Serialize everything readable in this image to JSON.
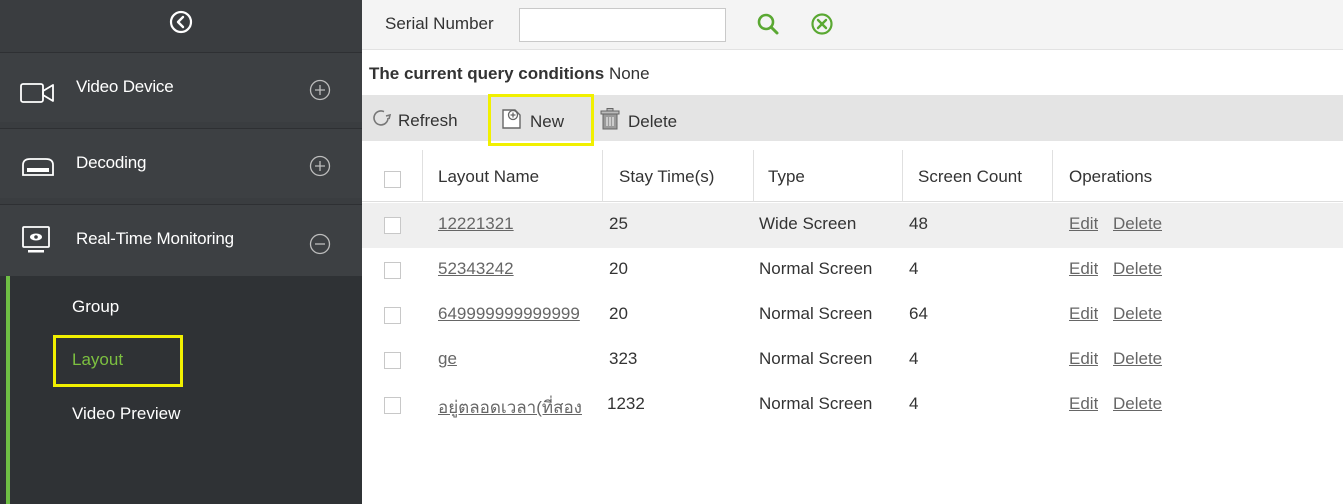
{
  "sidebar": {
    "collapse_icon": "circle-chevron-left-icon",
    "items": [
      {
        "label": "Video Device",
        "icon": "video-camera-icon",
        "toggle": "plus"
      },
      {
        "label": "Decoding",
        "icon": "decoder-icon",
        "toggle": "plus"
      },
      {
        "label": "Real-Time Monitoring",
        "icon": "monitor-eye-icon",
        "toggle": "minus"
      }
    ],
    "sub_items": [
      {
        "label": "Group",
        "active": false
      },
      {
        "label": "Layout",
        "active": true
      },
      {
        "label": "Video Preview",
        "active": false
      }
    ]
  },
  "filter": {
    "serial_label": "Serial Number",
    "serial_value": ""
  },
  "query": {
    "label": "The current query conditions",
    "value": "None"
  },
  "toolbar": {
    "refresh_label": "Refresh",
    "new_label": "New",
    "delete_label": "Delete"
  },
  "table": {
    "headers": [
      "Layout Name",
      "Stay Time(s)",
      "Type",
      "Screen Count",
      "Operations"
    ],
    "rows": [
      {
        "name": "12221321",
        "stay": "25",
        "type": "Wide Screen",
        "count": "48"
      },
      {
        "name": "52343242",
        "stay": "20",
        "type": "Normal Screen",
        "count": "4"
      },
      {
        "name": "649999999999999",
        "stay": "20",
        "type": "Normal Screen",
        "count": "64"
      },
      {
        "name": "ge",
        "stay": "323",
        "type": "Normal Screen",
        "count": "4"
      },
      {
        "name": "อยู่ตลอดเวลา(ที่สอง",
        "stay": "1232",
        "type": "Normal Screen",
        "count": "4"
      }
    ],
    "edit_label": "Edit",
    "delete_label": "Delete"
  },
  "colors": {
    "sidebar_bg": "#3a3d40",
    "accent_green": "#6fbe44",
    "highlight_yellow": "#f1f000"
  }
}
